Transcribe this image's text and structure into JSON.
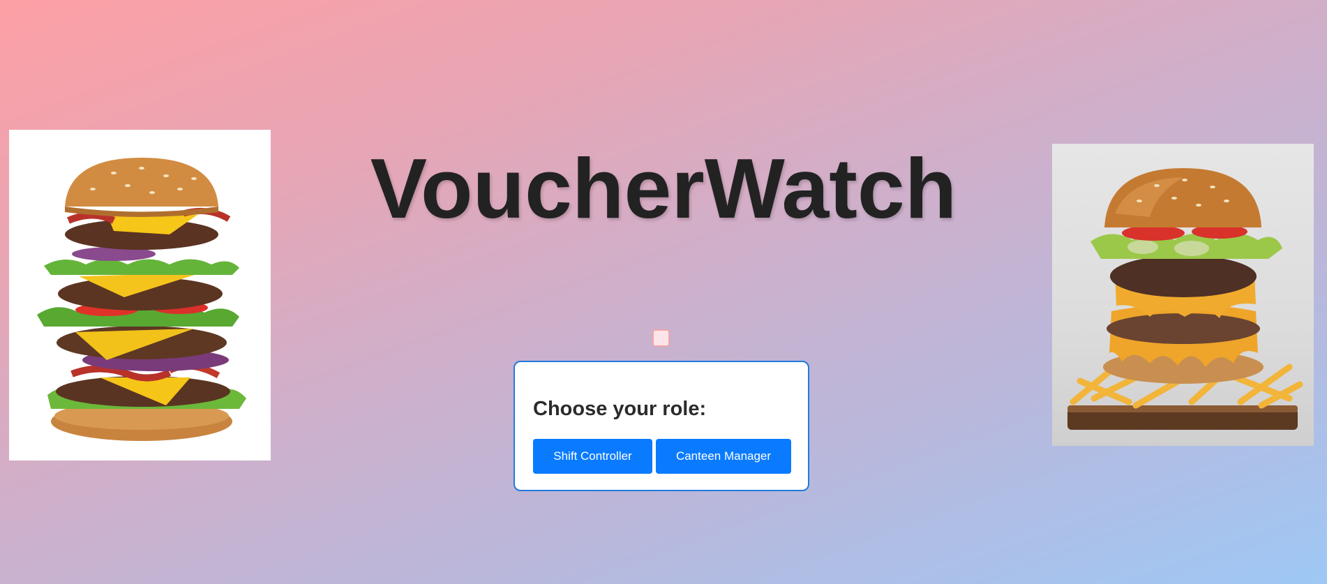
{
  "app": {
    "title": "VoucherWatch"
  },
  "role_card": {
    "heading": "Choose your role:",
    "buttons": [
      {
        "label": "Shift Controller"
      },
      {
        "label": "Canteen Manager"
      }
    ]
  },
  "images": {
    "left": "stacked-cheeseburger-image",
    "right": "burger-with-fries-image"
  },
  "colors": {
    "button": "#0a7bff",
    "card_border": "#1f7ae0",
    "title": "#222222",
    "gradient_start": "#fda0a5",
    "gradient_end": "#9ec8f5"
  }
}
